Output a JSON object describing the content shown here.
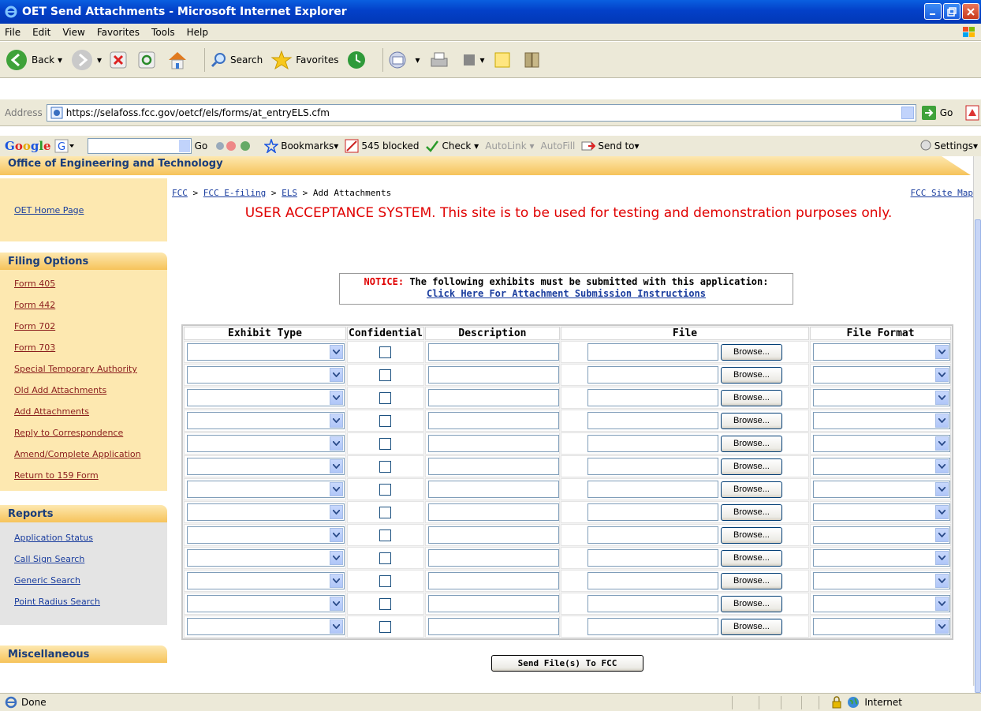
{
  "window": {
    "title": "OET Send Attachments - Microsoft Internet Explorer"
  },
  "menu": [
    "File",
    "Edit",
    "View",
    "Favorites",
    "Tools",
    "Help"
  ],
  "toolbar": {
    "back": "Back",
    "search": "Search",
    "favorites": "Favorites"
  },
  "address": {
    "label": "Address",
    "url": "https://selafoss.fcc.gov/oetcf/els/forms/at_entryELS.cfm",
    "go": "Go"
  },
  "googlebar": {
    "logo": "Google",
    "go": "Go",
    "bookmarks": "Bookmarks▾",
    "blocked": "545 blocked",
    "check": "Check ▾",
    "autolink": "AutoLink ▾",
    "autofill": "AutoFill",
    "sendto": "Send to▾",
    "settings": "Settings▾"
  },
  "banner": "Office of Engineering and Technology",
  "sidebar": {
    "home": "OET Home Page",
    "filing_title": "Filing Options",
    "filing": [
      "Form 405",
      "Form 442",
      "Form 702",
      "Form 703",
      "Special Temporary Authority",
      "Old Add Attachments",
      "Add Attachments",
      "Reply to Correspondence",
      "Amend/Complete Application",
      "Return to 159 Form"
    ],
    "reports_title": "Reports",
    "reports": [
      "Application Status",
      "Call Sign Search",
      "Generic Search",
      "Point Radius Search"
    ],
    "misc_title": "Miscellaneous"
  },
  "breadcrumb": {
    "fcc": "FCC",
    "sep1": " > ",
    "efiling": "FCC E-filing",
    "sep2": " > ",
    "els": "ELS",
    "rest": " > Add Attachments",
    "sitemap": "FCC Site Map"
  },
  "uat_notice": "USER ACCEPTANCE SYSTEM. This site is to be used for testing and demonstration purposes only.",
  "notice": {
    "label": "NOTICE:",
    "text": " The following exhibits must be submitted with this application:",
    "link": "Click Here For Attachment Submission Instructions"
  },
  "table": {
    "headers": [
      "Exhibit Type",
      "Confidential",
      "Description",
      "File",
      "File Format"
    ],
    "browse": "Browse...",
    "row_count": 13
  },
  "send_button": "Send File(s) To FCC",
  "status": {
    "text": "Done",
    "zone": "Internet"
  }
}
